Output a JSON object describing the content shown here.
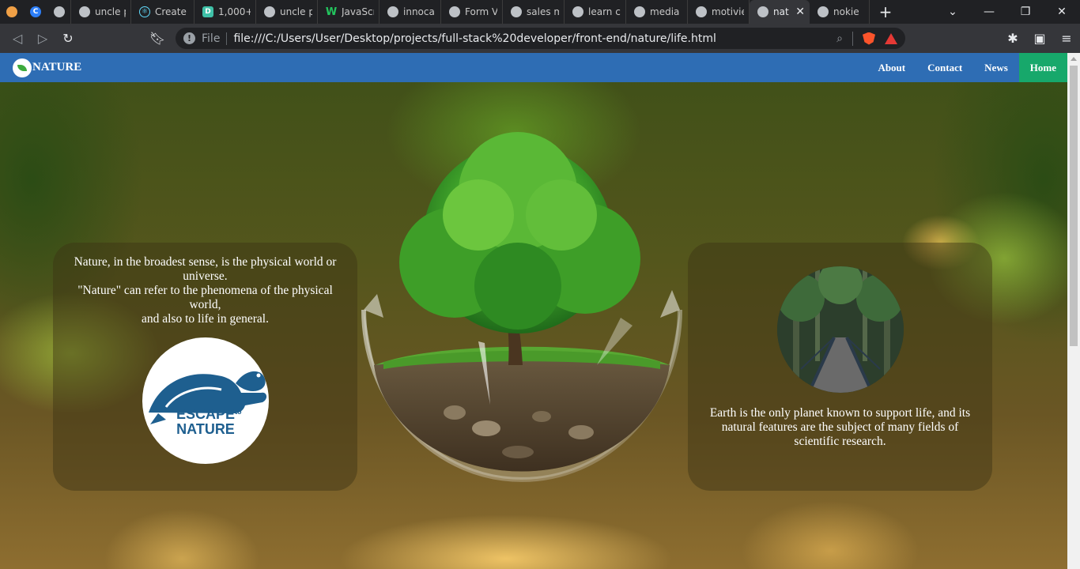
{
  "browser": {
    "tabs": [
      {
        "label": "uncle p",
        "icon": "globe-icon"
      },
      {
        "label": "Create a",
        "icon": "react-icon"
      },
      {
        "label": "1,000+",
        "icon": "d-icon"
      },
      {
        "label": "uncle p",
        "icon": "globe-icon"
      },
      {
        "label": "JavaScr",
        "icon": "w-icon"
      },
      {
        "label": "innocal",
        "icon": "globe-icon"
      },
      {
        "label": "Form V",
        "icon": "globe-icon"
      },
      {
        "label": "sales m",
        "icon": "globe-icon"
      },
      {
        "label": "learn ch",
        "icon": "globe-icon"
      },
      {
        "label": "media",
        "icon": "globe-icon"
      },
      {
        "label": "motivie",
        "icon": "globe-icon"
      },
      {
        "label": "natu",
        "icon": "globe-icon",
        "active": true
      },
      {
        "label": "nokie",
        "icon": "globe-icon"
      }
    ],
    "new_tab": "+",
    "scheme": "File",
    "url": "file:///C:/Users/User/Desktop/projects/full-stack%20developer/front-end/nature/life.html"
  },
  "site": {
    "brand": "NATURE",
    "nav": [
      "About",
      "Contact",
      "News",
      "Home"
    ],
    "active_nav": "Home",
    "accent_color": "#2e6db4",
    "active_color": "#17a86b",
    "left_card": {
      "lines": [
        "Nature, in the broadest sense, is the physical world or universe.",
        "\"Nature\" can refer to the phenomena of the physical world,",
        "and also to life in general."
      ],
      "logo_text_1": "ESCAPE",
      "logo_text_2": "NATURE",
      "logo_text_to": "to"
    },
    "right_card": {
      "text": "Earth is the only planet known to support life, and its natural features are the subject of many fields of scientific research."
    }
  }
}
